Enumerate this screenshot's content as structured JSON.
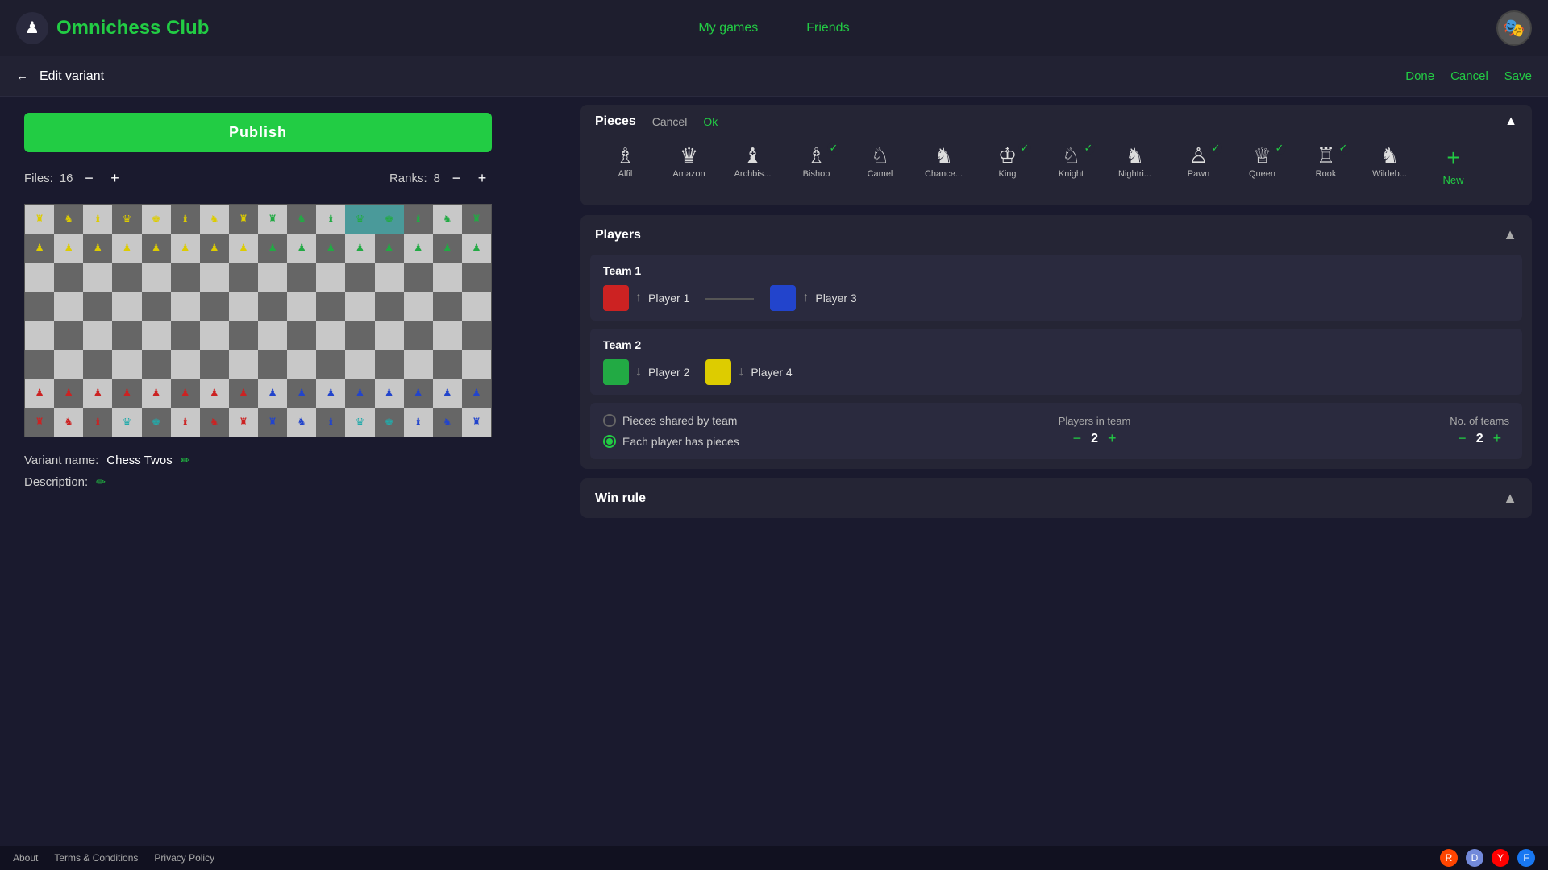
{
  "app": {
    "name": "Omnichess Club",
    "logo_emoji": "♟"
  },
  "header": {
    "nav": [
      {
        "label": "My games",
        "href": "#"
      },
      {
        "label": "Friends",
        "href": "#"
      }
    ],
    "avatar_emoji": "🎭"
  },
  "edit_bar": {
    "back_label": "←",
    "title": "Edit variant",
    "actions": {
      "done": "Done",
      "cancel": "Cancel",
      "save": "Save"
    }
  },
  "board": {
    "publish_label": "Publish",
    "files_label": "Files:",
    "files_value": "16",
    "ranks_label": "Ranks:",
    "ranks_value": "8"
  },
  "variant": {
    "name_label": "Variant name:",
    "name_value": "Chess Twos",
    "description_label": "Description:"
  },
  "pieces_section": {
    "title": "Pieces",
    "cancel_label": "Cancel",
    "ok_label": "Ok",
    "pieces": [
      {
        "name": "Alfil",
        "icon": "♝",
        "selected": false
      },
      {
        "name": "Amazon",
        "icon": "♛",
        "selected": false
      },
      {
        "name": "Archbis...",
        "icon": "♝",
        "selected": false
      },
      {
        "name": "Bishop",
        "icon": "♗",
        "selected": true
      },
      {
        "name": "Camel",
        "icon": "🐪",
        "selected": false
      },
      {
        "name": "Chance...",
        "icon": "♞",
        "selected": false
      },
      {
        "name": "King",
        "icon": "♔",
        "selected": true
      },
      {
        "name": "Knight",
        "icon": "♘",
        "selected": true
      },
      {
        "name": "Nightri...",
        "icon": "♞",
        "selected": false
      },
      {
        "name": "Pawn",
        "icon": "♟",
        "selected": true
      },
      {
        "name": "Queen",
        "icon": "♕",
        "selected": true
      },
      {
        "name": "Rook",
        "icon": "♖",
        "selected": true
      },
      {
        "name": "Wildeb...",
        "icon": "🐃",
        "selected": false
      },
      {
        "name": "New",
        "icon": "+",
        "is_new": true
      }
    ]
  },
  "players_section": {
    "title": "Players",
    "teams": [
      {
        "title": "Team 1",
        "players": [
          {
            "color": "#cc2222",
            "arrow": "↑",
            "name": "Player 1"
          },
          {
            "color": "#2244cc",
            "arrow": "↑",
            "name": "Player 3"
          }
        ]
      },
      {
        "title": "Team 2",
        "players": [
          {
            "color": "#22aa44",
            "arrow": "↓",
            "name": "Player 2"
          },
          {
            "color": "#ddcc00",
            "arrow": "↓",
            "name": "Player 4"
          }
        ]
      }
    ],
    "config": {
      "options": [
        {
          "label": "Pieces shared by team",
          "active": false
        },
        {
          "label": "Each player has pieces",
          "active": true
        }
      ],
      "players_in_team_label": "Players in team",
      "players_in_team_value": "2",
      "no_of_teams_label": "No. of teams",
      "no_of_teams_value": "2"
    }
  },
  "win_rule_section": {
    "title": "Win rule"
  },
  "footer": {
    "links": [
      {
        "label": "About",
        "href": "#"
      },
      {
        "label": "Terms & Conditions",
        "href": "#"
      },
      {
        "label": "Privacy Policy",
        "href": "#"
      }
    ],
    "socials": [
      {
        "name": "reddit",
        "color": "#ff4500",
        "icon": "R"
      },
      {
        "name": "discord",
        "color": "#7289da",
        "icon": "D"
      },
      {
        "name": "youtube",
        "color": "#ff0000",
        "icon": "Y"
      },
      {
        "name": "facebook",
        "color": "#1877f2",
        "icon": "F"
      }
    ]
  }
}
